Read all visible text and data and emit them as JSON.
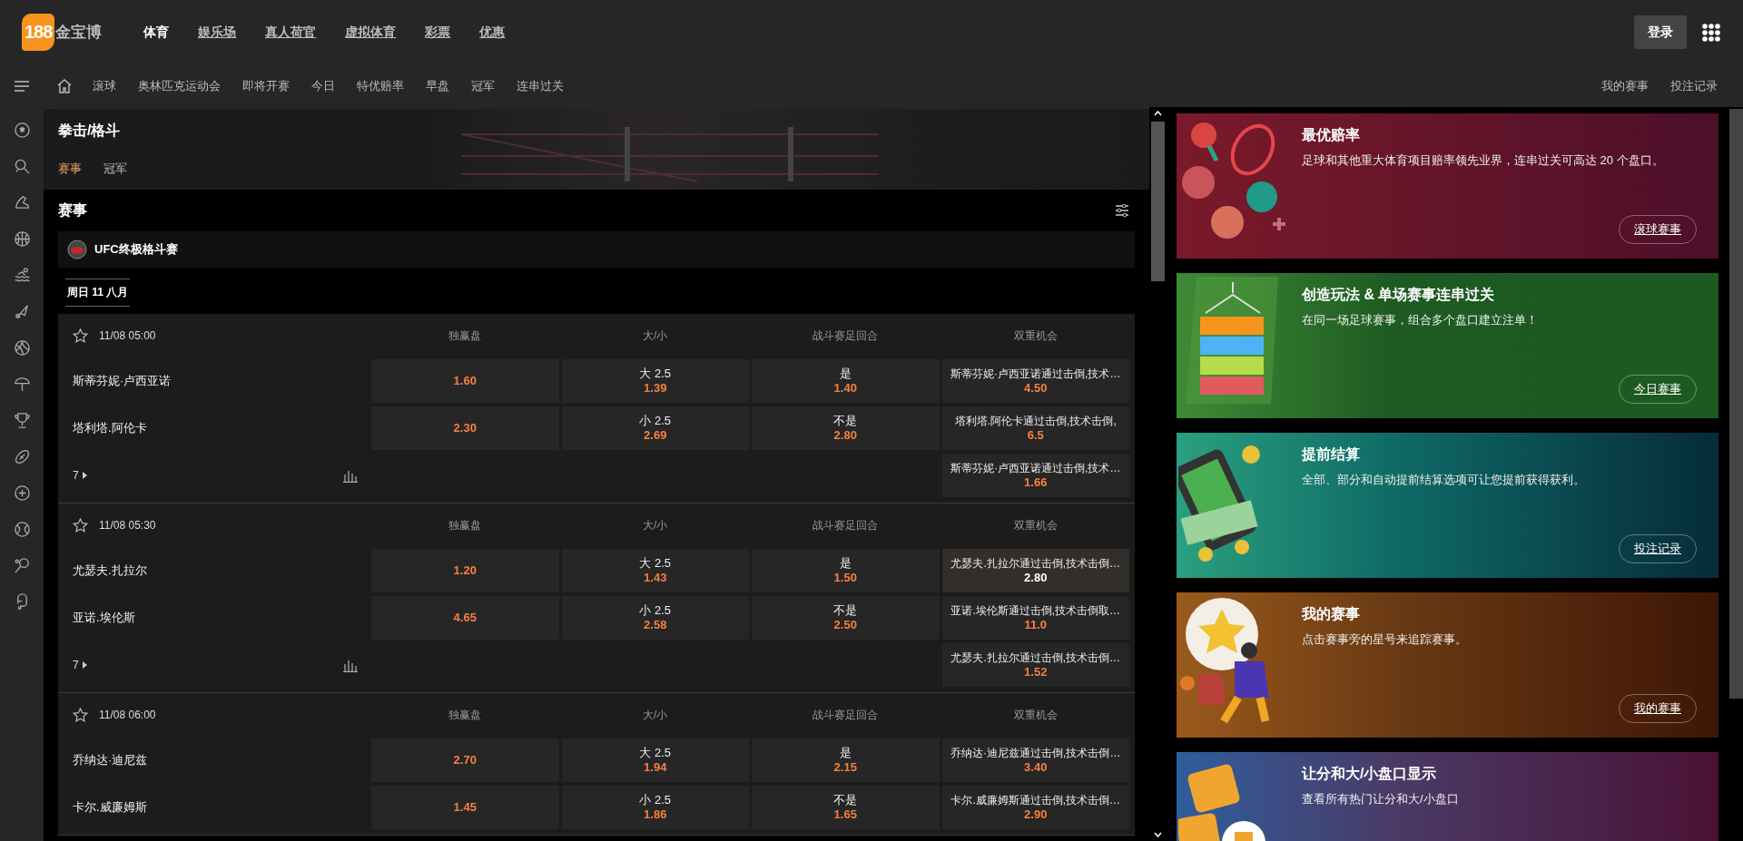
{
  "logo": {
    "numerals": "188",
    "text": "金宝博"
  },
  "top_nav": [
    {
      "label": "体育",
      "selected": true
    },
    {
      "label": "娱乐场",
      "selected": false
    },
    {
      "label": "真人荷官",
      "selected": false
    },
    {
      "label": "虚拟体育",
      "selected": false
    },
    {
      "label": "彩票",
      "selected": false
    },
    {
      "label": "优惠",
      "selected": false
    }
  ],
  "login_button": "登录",
  "sub_nav": {
    "items": [
      "滚球",
      "奥林匹克运动会",
      "即将开赛",
      "今日",
      "特优赔率",
      "早盘",
      "冠军",
      "连串过关"
    ],
    "right_links": [
      "我的赛事",
      "投注记录"
    ]
  },
  "sport": {
    "title": "拳击/格斗",
    "tabs": [
      {
        "label": "赛事",
        "selected": true
      },
      {
        "label": "冠军",
        "selected": false
      }
    ]
  },
  "events": {
    "heading": "赛事",
    "league": "UFC终极格斗赛",
    "date_tab": "周日 11 八月",
    "matches": [
      {
        "time": "11/08 05:00",
        "favorite": false,
        "markets": [
          "独赢盘",
          "大/小",
          "战斗赛足回合",
          "双重机会"
        ],
        "rows": [
          {
            "name": "斯蒂芬妮·卢西亚诺",
            "odds": [
              {
                "price": "1.60",
                "selected": false
              },
              {
                "label": "大 2.5",
                "price": "1.39",
                "selected": false
              },
              {
                "label": "是",
                "price": "1.40",
                "selected": false
              },
              {
                "label": "斯蒂芬妮·卢西亚诺通过击倒,技术…",
                "price": "4.50",
                "selected": false
              }
            ]
          },
          {
            "name": "塔利塔.阿伦卡",
            "odds": [
              {
                "price": "2.30",
                "selected": false
              },
              {
                "label": "小 2.5",
                "price": "2.69",
                "selected": false
              },
              {
                "label": "不是",
                "price": "2.80",
                "selected": false
              },
              {
                "label": "塔利塔.阿伦卡通过击倒,技术击倒,",
                "price": "6.5",
                "selected": false
              }
            ]
          }
        ],
        "more_count": "7",
        "extra_odds": {
          "label": "斯蒂芬妮·卢西亚诺通过击倒,技术…",
          "price": "1.66",
          "selected": false
        }
      },
      {
        "time": "11/08 05:30",
        "favorite": false,
        "markets": [
          "独赢盘",
          "大/小",
          "战斗赛足回合",
          "双重机会"
        ],
        "rows": [
          {
            "name": "尤瑟夫.扎拉尔",
            "odds": [
              {
                "price": "1.20",
                "selected": false
              },
              {
                "label": "大 2.5",
                "price": "1.43",
                "selected": false
              },
              {
                "label": "是",
                "price": "1.50",
                "selected": false
              },
              {
                "label": "尤瑟夫.扎拉尔通过击倒,技术击倒…",
                "price": "2.80",
                "selected": true
              }
            ]
          },
          {
            "name": "亚诺.埃伦斯",
            "odds": [
              {
                "price": "4.65",
                "selected": false
              },
              {
                "label": "小 2.5",
                "price": "2.58",
                "selected": false
              },
              {
                "label": "不是",
                "price": "2.50",
                "selected": false
              },
              {
                "label": "亚诺.埃伦斯通过击倒,技术击倒取…",
                "price": "11.0",
                "selected": false
              }
            ]
          }
        ],
        "more_count": "7",
        "extra_odds": {
          "label": "尤瑟夫.扎拉尔通过击倒,技术击倒…",
          "price": "1.52",
          "selected": false
        }
      },
      {
        "time": "11/08 06:00",
        "favorite": false,
        "markets": [
          "独赢盘",
          "大/小",
          "战斗赛足回合",
          "双重机会"
        ],
        "rows": [
          {
            "name": "乔纳达·迪尼兹",
            "odds": [
              {
                "price": "2.70",
                "selected": false
              },
              {
                "label": "大 2.5",
                "price": "1.94",
                "selected": false
              },
              {
                "label": "是",
                "price": "2.15",
                "selected": false
              },
              {
                "label": "乔纳达·迪尼兹通过击倒,技术击倒…",
                "price": "3.40",
                "selected": false
              }
            ]
          },
          {
            "name": "卡尔.威廉姆斯",
            "odds": [
              {
                "price": "1.45",
                "selected": false
              },
              {
                "label": "小 2.5",
                "price": "1.86",
                "selected": false
              },
              {
                "label": "不是",
                "price": "1.65",
                "selected": false
              },
              {
                "label": "卡尔.威廉姆斯通过击倒,技术击倒…",
                "price": "2.90",
                "selected": false
              }
            ]
          }
        ]
      }
    ]
  },
  "banners": [
    {
      "kind": "sports",
      "title": "最优赔率",
      "text": "足球和其他重大体育项目赔率领先业界，连串过关可高达 20 个盘口。",
      "button": "滚球赛事"
    },
    {
      "kind": "parlay",
      "title": "创造玩法 & 单场赛事连串过关",
      "text": "在同一场足球赛事，组合多个盘口建立注单！",
      "button": "今日赛事"
    },
    {
      "kind": "cashout",
      "title": "提前结算",
      "text": "全部、部分和自动提前结算选项可让您提前获得获利。",
      "button": "投注记录"
    },
    {
      "kind": "favorites",
      "title": "我的赛事",
      "text": "点击赛事旁的星号来追踪赛事。",
      "button": "我的赛事"
    },
    {
      "kind": "handicap",
      "title": "让分和大/小盘口显示",
      "text": "查看所有热门让分和大/小盘口"
    }
  ]
}
